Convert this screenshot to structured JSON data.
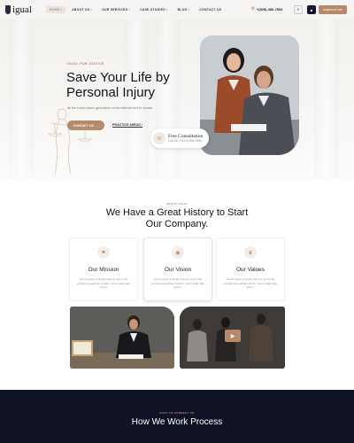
{
  "header": {
    "logo": "igual",
    "nav": [
      {
        "label": "HOME",
        "active": true
      },
      {
        "label": "ABOUT US",
        "active": false
      },
      {
        "label": "OUR SERVICES",
        "active": false
      },
      {
        "label": "CASE STUDIES",
        "active": false
      },
      {
        "label": "BLOG",
        "active": false
      },
      {
        "label": "CONTACT US",
        "active": false
      }
    ],
    "phone": "+(528) 456-7592",
    "contact_button": "CONTACT US"
  },
  "hero": {
    "eyebrow": "IGUAL FOR JUSTICE",
    "title": "Save Your Life by Personal Injury",
    "description": "All the Lorem Ipsum generators on the Internet tend to chunks",
    "primary_button": "CONTACT US",
    "secondary_link": "PRACTICE AREAS",
    "consult_title": "Free Consultation",
    "consult_phone": "Call Us: (+123) 456-7890"
  },
  "about": {
    "badge": "ABOUT IGUAL",
    "title": "We Have a Great History to Start Our Company.",
    "cards": [
      {
        "title": "Our Mission",
        "desc": "Lorem ipsum is simply dummy text of the printing typesetting industry. Lorem data rade ipsum."
      },
      {
        "title": "Our Vision",
        "desc": "Lorem ipsum is simply dummy text of the printing typesetting industry. Lorem data rade ipsum."
      },
      {
        "title": "Our Values",
        "desc": "Lorem ipsum is simply dummy text of the printing typesetting industry. Lorem data rade ipsum."
      }
    ]
  },
  "process": {
    "badge": "EASY TO CONNECT US",
    "title": "How We Work Process"
  }
}
